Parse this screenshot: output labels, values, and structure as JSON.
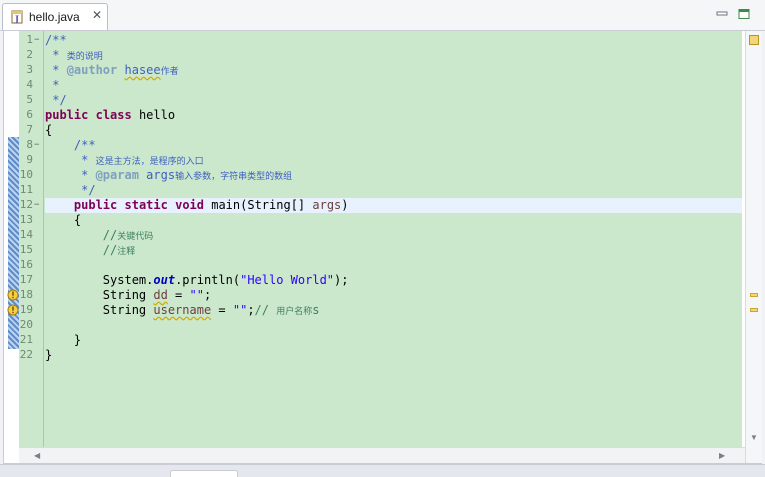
{
  "tab": {
    "title": "hello.java"
  },
  "lines": [
    {
      "no": "1",
      "fold": "−",
      "parts": [
        [
          "jd",
          "/**"
        ]
      ]
    },
    {
      "no": "2",
      "parts": [
        [
          "jd",
          " * "
        ],
        [
          "jd cjk",
          "类的说明"
        ]
      ]
    },
    {
      "no": "3",
      "parts": [
        [
          "jd",
          " * "
        ],
        [
          "tag",
          "@author"
        ],
        [
          "jd",
          " "
        ],
        [
          "jd warnline",
          "hasee"
        ],
        [
          "jd cjk",
          "作者"
        ]
      ]
    },
    {
      "no": "4",
      "parts": [
        [
          "jd",
          " *"
        ]
      ]
    },
    {
      "no": "5",
      "parts": [
        [
          "jd",
          " */"
        ]
      ]
    },
    {
      "no": "6",
      "parts": [
        [
          "kw",
          "public"
        ],
        [
          "",
          " "
        ],
        [
          "kw",
          "class"
        ],
        [
          "",
          " hello"
        ]
      ]
    },
    {
      "no": "7",
      "parts": [
        [
          "",
          "{"
        ]
      ]
    },
    {
      "no": "8",
      "fold": "−",
      "parts": [
        [
          "jd",
          "    /**"
        ]
      ]
    },
    {
      "no": "9",
      "parts": [
        [
          "jd",
          "     * "
        ],
        [
          "jd cjk",
          "这是主方法，是程序的入口"
        ]
      ]
    },
    {
      "no": "10",
      "parts": [
        [
          "jd",
          "     * "
        ],
        [
          "tag",
          "@param"
        ],
        [
          "jd",
          " args"
        ],
        [
          "jd cjk",
          "输入参数，字符串类型的数组"
        ]
      ]
    },
    {
      "no": "11",
      "parts": [
        [
          "jd",
          "     */"
        ]
      ]
    },
    {
      "no": "12",
      "fold": "−",
      "current": true,
      "parts": [
        [
          "",
          "    "
        ],
        [
          "kw",
          "public"
        ],
        [
          "",
          " "
        ],
        [
          "kw",
          "static"
        ],
        [
          "",
          " "
        ],
        [
          "kw",
          "void"
        ],
        [
          "",
          " main(String[] "
        ],
        [
          "var",
          "args"
        ],
        [
          "",
          ")"
        ]
      ]
    },
    {
      "no": "13",
      "parts": [
        [
          "",
          "    {"
        ]
      ]
    },
    {
      "no": "14",
      "parts": [
        [
          "cm",
          "        //"
        ],
        [
          "cm cjk",
          "关键代码"
        ]
      ]
    },
    {
      "no": "15",
      "parts": [
        [
          "cm",
          "        //"
        ],
        [
          "cm cjk",
          "注释"
        ]
      ]
    },
    {
      "no": "16",
      "parts": [
        [
          "",
          ""
        ]
      ]
    },
    {
      "no": "17",
      "parts": [
        [
          "",
          "        System."
        ],
        [
          "fld",
          "out"
        ],
        [
          "",
          ".println("
        ],
        [
          "str",
          "\"Hello World\""
        ],
        [
          "",
          ");"
        ]
      ]
    },
    {
      "no": "18",
      "parts": [
        [
          "",
          "        String "
        ],
        [
          "var warnline",
          "dd"
        ],
        [
          "",
          " = "
        ],
        [
          "str",
          "\"\""
        ],
        [
          "",
          ";"
        ]
      ]
    },
    {
      "no": "19",
      "parts": [
        [
          "",
          "        String "
        ],
        [
          "var warnline",
          "username"
        ],
        [
          "",
          " = "
        ],
        [
          "str",
          "\"\""
        ],
        [
          "",
          ";"
        ],
        [
          "cm",
          "// "
        ],
        [
          "cm cjk",
          "用户名称"
        ],
        [
          "cm",
          "s"
        ]
      ]
    },
    {
      "no": "20",
      "parts": [
        [
          "",
          ""
        ]
      ]
    },
    {
      "no": "21",
      "parts": [
        [
          "",
          "    }"
        ]
      ]
    },
    {
      "no": "22",
      "parts": [
        [
          "",
          "}"
        ]
      ]
    }
  ],
  "colors": {
    "editor_bg": "#cbe8cd",
    "current_line": "#e8f2fe",
    "keyword": "#7f0055",
    "javadoc": "#3f5fbf",
    "comment": "#3f7f5f",
    "string": "#2a00ff"
  }
}
